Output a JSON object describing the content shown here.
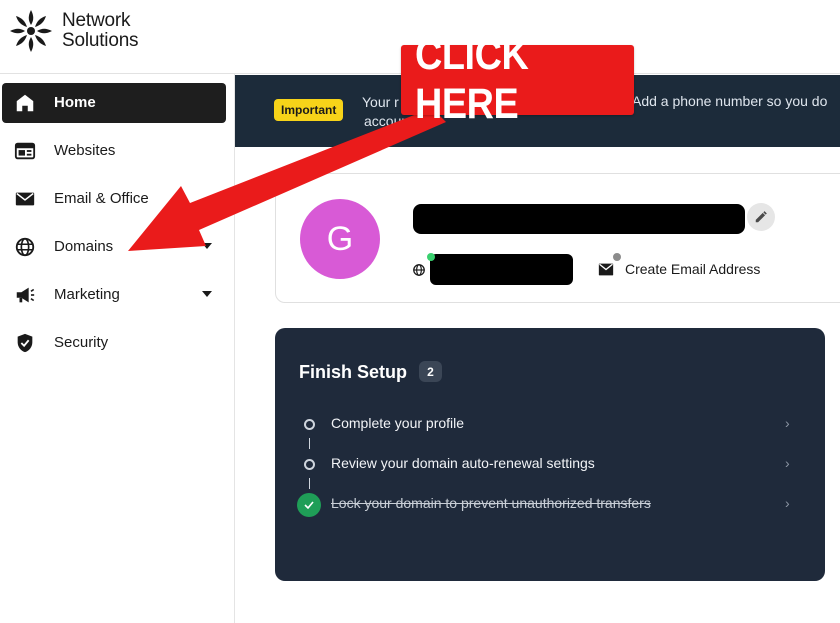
{
  "header": {
    "logo_line1": "Network",
    "logo_line2": "Solutions"
  },
  "sidebar": {
    "items": [
      {
        "label": "Home",
        "icon": "home-icon",
        "active": true
      },
      {
        "label": "Websites",
        "icon": "browser-window-icon"
      },
      {
        "label": "Email & Office",
        "icon": "envelope-icon"
      },
      {
        "label": "Domains",
        "icon": "globe-icon",
        "has_chevron": true
      },
      {
        "label": "Marketing",
        "icon": "megaphone-icon",
        "has_chevron": true
      },
      {
        "label": "Security",
        "icon": "shield-check-icon"
      }
    ]
  },
  "banner": {
    "badge": "Important",
    "text_left": "Your r",
    "text_right": "Add a phone number so you do",
    "text_line2": "account."
  },
  "profile": {
    "avatar_initial": "G",
    "create_email_label": "Create Email Address"
  },
  "setup": {
    "title": "Finish Setup",
    "count": "2",
    "steps": [
      {
        "label": "Complete your profile",
        "done": false
      },
      {
        "label": "Review your domain auto-renewal settings",
        "done": false
      },
      {
        "label": "Lock your domain to prevent unauthorized transfers",
        "done": true
      }
    ]
  },
  "annotation": {
    "callout_text": "CLICK HERE"
  },
  "colors": {
    "accent_red": "#ea1b1b",
    "banner_bg": "#1c2b3a",
    "setup_bg": "#1f2a3b",
    "badge_yellow": "#f7d319",
    "avatar_purple": "#d85ad6",
    "success_green": "#1f9e57"
  }
}
